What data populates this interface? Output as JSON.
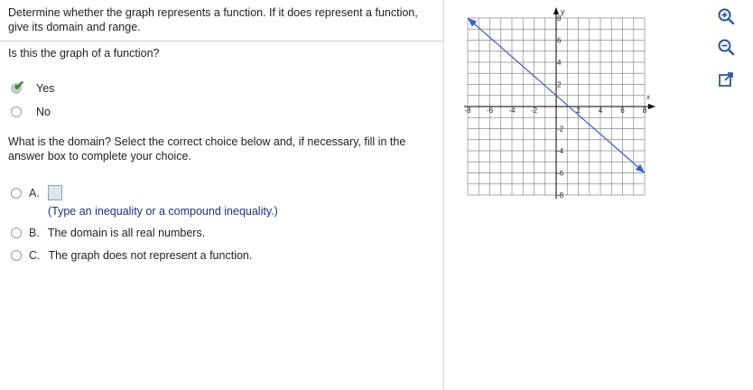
{
  "question": {
    "prompt_line1": "Determine whether the graph represents a function. If it does represent a function,",
    "prompt_line2": "give its domain and range."
  },
  "part1": {
    "question": "Is this the graph of a function?",
    "options": [
      {
        "label": "Yes",
        "selected": true
      },
      {
        "label": "No",
        "selected": false
      }
    ]
  },
  "part2": {
    "question_line1": "What is the domain? Select the correct choice below and, if necessary, fill in the",
    "question_line2": "answer box to complete your choice.",
    "choices": [
      {
        "letter": "A.",
        "text": "",
        "note": "(Type an inequality or a compound inequality.)"
      },
      {
        "letter": "B.",
        "text": "The domain is all real numbers."
      },
      {
        "letter": "C.",
        "text": "The graph does not represent a function."
      }
    ]
  },
  "graph": {
    "x_label": "x",
    "y_label": "y",
    "x_tick_labels": [
      "-8",
      "-6",
      "-4",
      "-2",
      "2",
      "4",
      "6",
      "8"
    ],
    "y_tick_labels": [
      "8",
      "6",
      "4",
      "2",
      "-2",
      "-4",
      "-6",
      "-8"
    ],
    "xlim": [
      -8,
      8
    ],
    "ylim": [
      -8,
      8
    ],
    "grid": true,
    "line": {
      "from": [
        -8,
        8
      ],
      "to": [
        8,
        -6
      ]
    },
    "colors": {
      "line": "#3a5fc8",
      "grid": "#8a8a8a",
      "axis": "#000000"
    }
  },
  "toolbar": {
    "icons": [
      "zoom-in-icon",
      "zoom-out-icon",
      "popout-icon"
    ]
  }
}
